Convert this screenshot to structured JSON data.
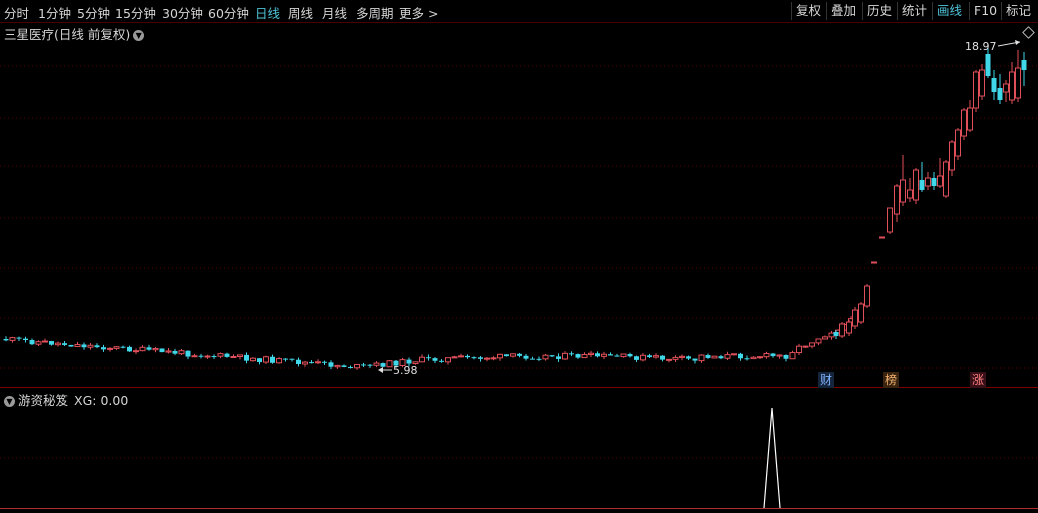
{
  "toolbar": {
    "periods": [
      "分时",
      "1分钟",
      "5分钟",
      "15分钟",
      "30分钟",
      "60分钟",
      "日线",
      "周线",
      "月线",
      "多周期",
      "更多 >"
    ],
    "active_period": "日线",
    "right_buttons": [
      "复权",
      "叠加",
      "历史",
      "统计",
      "画线",
      "F10",
      "标记"
    ],
    "active_right": "画线"
  },
  "chart": {
    "title": "三星医疗(日线 前复权)",
    "high_label": "18.97",
    "low_label": "5.98"
  },
  "event_tags": [
    "财",
    "榜",
    "涨"
  ],
  "indicator": {
    "name": "游资秘笈",
    "value": "XG: 0.00",
    "signal_count": 1
  },
  "colors": {
    "up": "#e0505a",
    "down": "#40d8e8",
    "grid": "#5a0000",
    "active_text": "#4fc3d8"
  }
}
